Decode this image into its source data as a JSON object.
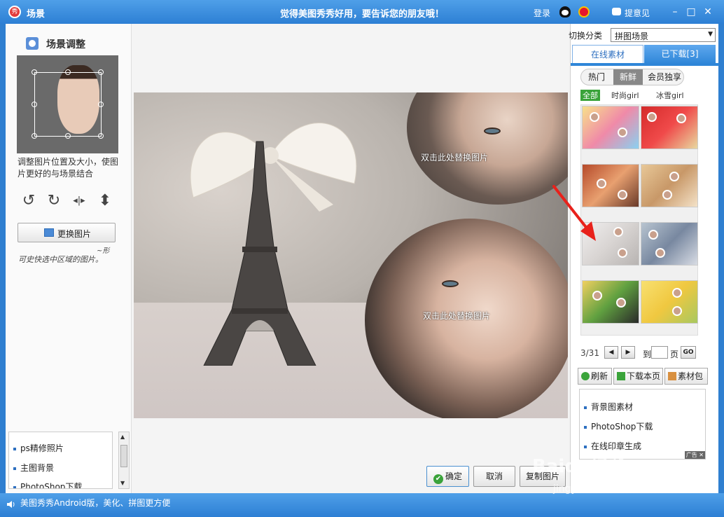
{
  "titlebar": {
    "app_icon": "秀",
    "title": "场景",
    "slogan": "觉得美图秀秀好用，要告诉您的朋友哦！",
    "login": "登录",
    "feedback": "提意见",
    "min": "–",
    "max": "□",
    "close": "✕"
  },
  "left": {
    "title": "场景调整",
    "hint": "调整图片位置及大小，使图片更好的与场景结合",
    "rotate_left": "↺",
    "rotate_right": "↻",
    "flip_h": "◂|▸",
    "flip_v": "⬍",
    "change_button": "更换图片",
    "scribble": "可史快选中区域的图片。",
    "scribble_sig": "~形",
    "links": [
      "ps精修照片",
      "主图背景",
      "PhotoShop下载"
    ]
  },
  "canvas": {
    "replace_top": "双击此处替换图片",
    "replace_bottom": "双击此处替换图片"
  },
  "right": {
    "switch_label": "切换分类",
    "select_value": "拼图场景",
    "tab_online": "在线素材",
    "tab_downloaded": "已下载[3]",
    "subtabs": [
      "热门",
      "新鲜",
      "会员独享"
    ],
    "filters": [
      "全部",
      "时尚girl",
      "冰雪girl"
    ],
    "pager_count": "3/31",
    "pager_to": "到",
    "pager_page": "页",
    "go": "GO",
    "actions": [
      "刷新",
      "下载本页",
      "素材包"
    ],
    "ads": [
      "背景图素材",
      "PhotoShop下载",
      "在线印章生成"
    ],
    "ad_badge": "广告 ✕"
  },
  "buttons": {
    "ok": "确定",
    "cancel": "取消",
    "copy": "复制图片"
  },
  "statusbar": {
    "text": "美图秀秀Android版，美化、拼图更方便"
  },
  "watermark": {
    "brand": "Baidu经验",
    "url": "jingyan.baidu.com"
  },
  "colors": {
    "titlebar": "#2d7fd4",
    "accent": "#2f86d8",
    "green": "#3aa33a",
    "arrow": "#e8211b"
  }
}
